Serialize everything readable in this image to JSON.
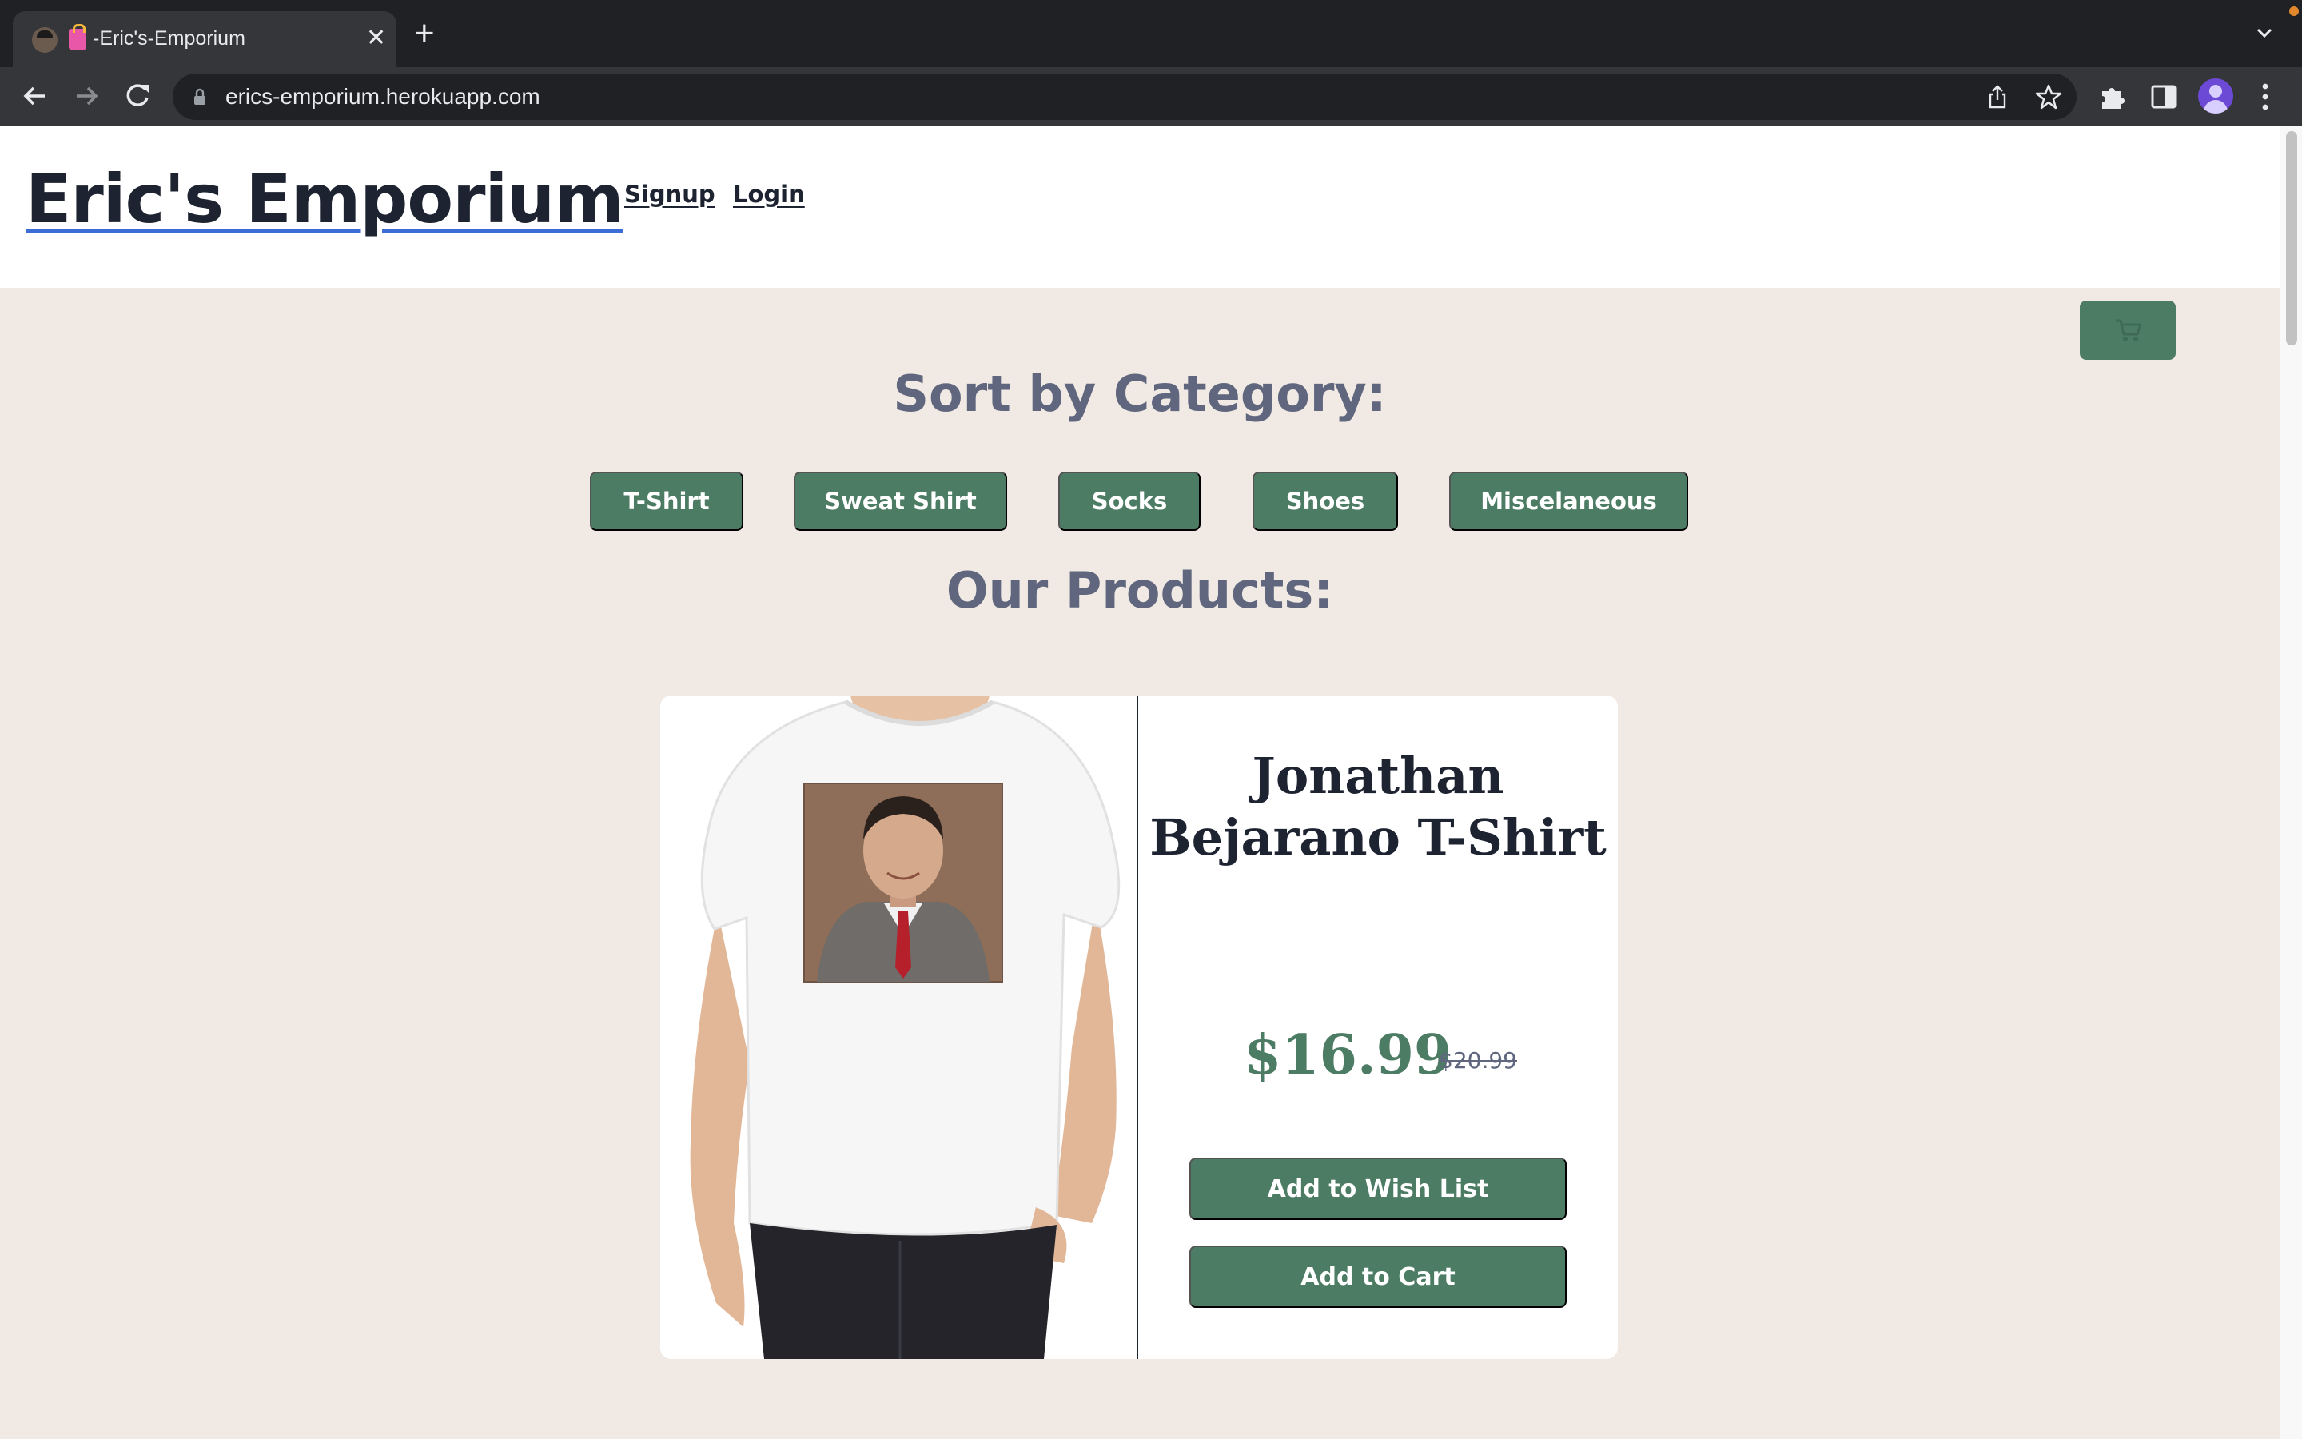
{
  "browser": {
    "tab_title": "‑Eric's‑Emporium",
    "url": "erics-emporium.herokuapp.com",
    "icons": [
      "back-icon",
      "forward-icon",
      "reload-icon",
      "lock-icon",
      "share-icon",
      "star-icon",
      "extensions-icon",
      "side-panel-icon",
      "profile-avatar",
      "menu-icon",
      "tab-close-icon",
      "new-tab-icon",
      "tab-list-icon"
    ]
  },
  "header": {
    "site_title": "Eric's Emporium",
    "nav": [
      {
        "label": "Signup"
      },
      {
        "label": "Login"
      }
    ]
  },
  "cart": {
    "icon": "cart-icon",
    "color": "#4d7c64"
  },
  "categories": {
    "heading": "Sort by Category:",
    "items": [
      {
        "label": "T-Shirt"
      },
      {
        "label": "Sweat Shirt"
      },
      {
        "label": "Socks"
      },
      {
        "label": "Shoes"
      },
      {
        "label": "Miscelaneous"
      }
    ]
  },
  "products": {
    "heading": "Our Products:",
    "items": [
      {
        "name": "Jonathan Bejarano T-Shirt",
        "price": "$16.99",
        "original_price": "$20.99",
        "wishlist_label": "Add to Wish List",
        "cart_label": "Add to Cart"
      }
    ]
  },
  "colors": {
    "accent": "#4d7c64",
    "background": "#f1eae4",
    "heading": "#5f667d",
    "text": "#1d2330",
    "underline": "#3c6cd8"
  }
}
